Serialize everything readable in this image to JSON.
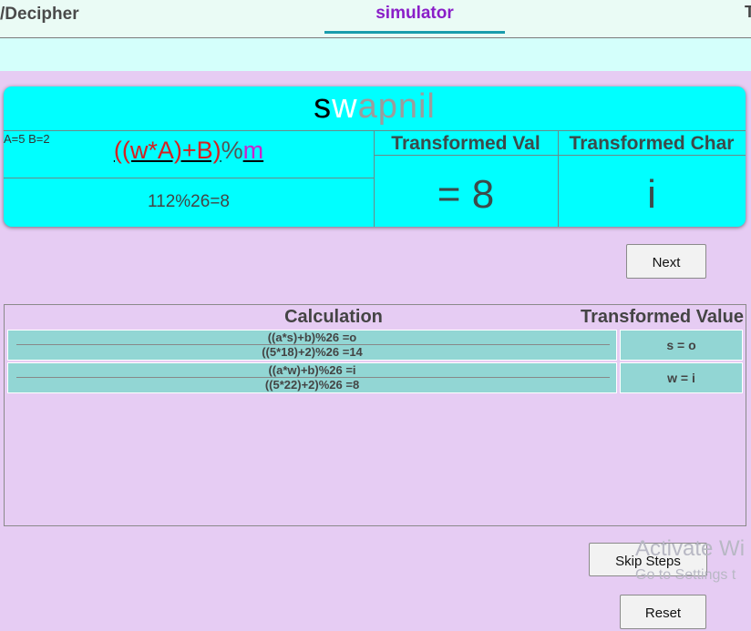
{
  "nav": {
    "title": "/Decipher",
    "tab_label": "simulator",
    "edge_fragment": "T"
  },
  "card": {
    "word": {
      "done": "s",
      "current": "w",
      "rest": "apnil"
    },
    "params": "A=5  B=2",
    "formula": {
      "expr": "((w*A)+B)",
      "op": "%",
      "mod": "m"
    },
    "calc": "112%26=8",
    "header_val": "Transformed Val",
    "header_char": "Transformed Char",
    "value": "= 8",
    "char": "i"
  },
  "buttons": {
    "next": "Next",
    "skip": "Skip Steps",
    "reset": "Reset"
  },
  "table": {
    "header_calc": "Calculation",
    "header_tv": "Transformed Value",
    "rows": [
      {
        "line1": "((a*s)+b)%26 =o",
        "line2": "((5*18)+2)%26 =14",
        "tv": "s = o"
      },
      {
        "line1": "((a*w)+b)%26 =i",
        "line2": "((5*22)+2)%26 =8",
        "tv": "w = i"
      }
    ]
  },
  "watermark": {
    "line1": "Activate Wi",
    "line2": "Go to Settings t"
  },
  "colors": {
    "background": "#e6ccf3",
    "card": "#00ffff",
    "accent": "#8a1ec8",
    "row_fill": "#92d6d4"
  }
}
